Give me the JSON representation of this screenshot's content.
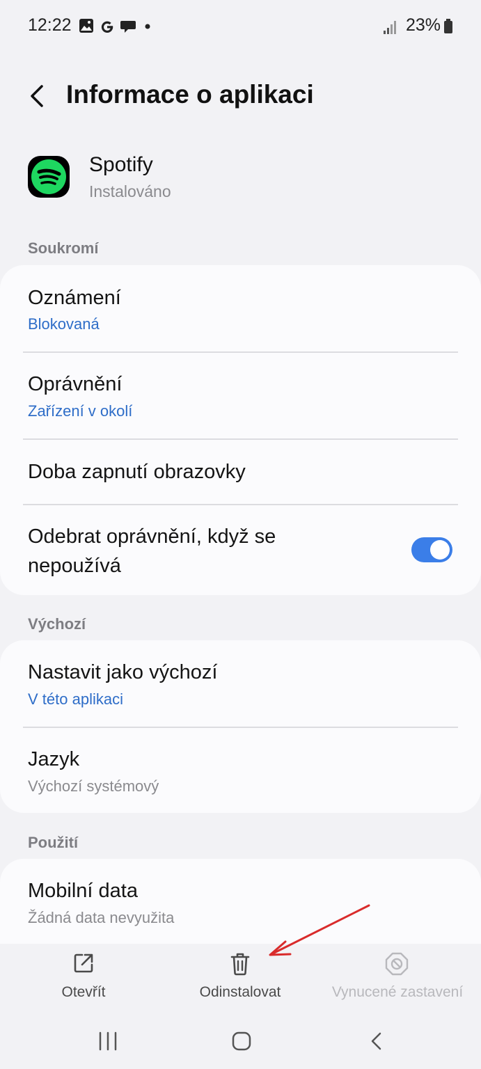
{
  "status_bar": {
    "time": "12:22",
    "battery": "23%",
    "icons": [
      "gallery-icon",
      "google-icon",
      "chat-icon",
      "dot-icon",
      "signal-icon",
      "battery-icon"
    ]
  },
  "header": {
    "title": "Informace o aplikaci",
    "back_icon": "chevron-left-icon"
  },
  "app": {
    "name": "Spotify",
    "status": "Instalováno",
    "brand_color": "#1ED760"
  },
  "sections": {
    "privacy": {
      "label": "Soukromí",
      "items": [
        {
          "title": "Oznámení",
          "subtitle": "Blokovaná"
        },
        {
          "title": "Oprávnění",
          "subtitle": "Zařízení v okolí"
        },
        {
          "title": "Doba zapnutí obrazovky"
        },
        {
          "title_line1": "Odebrat oprávnění, když se",
          "title_line2": "nepoužívá",
          "toggle_on": true
        }
      ]
    },
    "defaults": {
      "label": "Výchozí",
      "items": [
        {
          "title": "Nastavit jako výchozí",
          "subtitle": "V této aplikaci"
        },
        {
          "title": "Jazyk",
          "subtitle": "Výchozí systémový"
        }
      ]
    },
    "usage": {
      "label": "Použití",
      "items": [
        {
          "title": "Mobilní data",
          "subtitle": "Žádná data nevyužita"
        }
      ]
    }
  },
  "bottom_actions": {
    "open": "Otevřít",
    "uninstall": "Odinstalovat",
    "force_stop": "Vynucené zastavení"
  },
  "colors": {
    "accent_blue": "#2e6dc8",
    "toggle_on": "#3b7ee8",
    "annotation_arrow": "#d92b2b"
  }
}
